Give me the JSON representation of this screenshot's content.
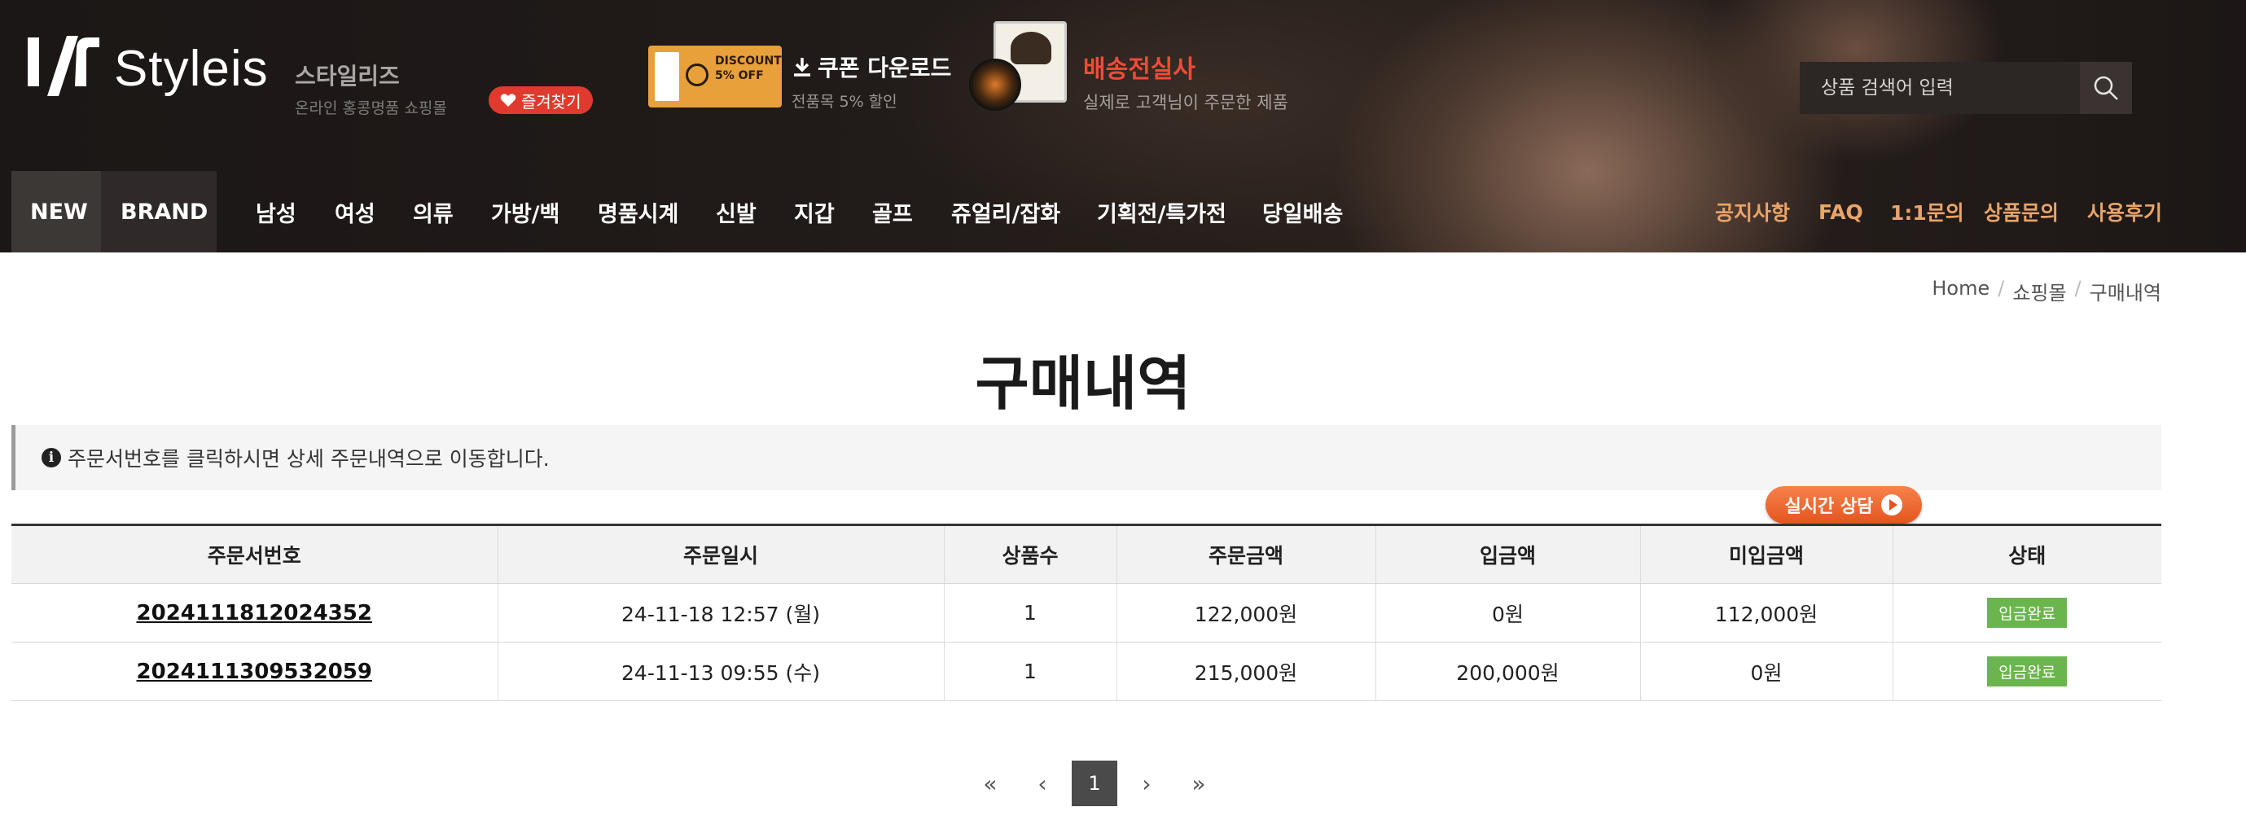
{
  "header": {
    "logo_text": "Styleis",
    "brand_korean": "스타일리즈",
    "brand_desc": "온라인 홍콩명품 쇼핑몰",
    "favorite_label": "즐겨찾기",
    "coupon_badge": "DISCOUNT 5% OFF",
    "coupon_title": "쿠폰 다운로드",
    "coupon_sub": "전품목 5% 할인",
    "delivery_title": "배송전실사",
    "delivery_sub": "실제로 고객님이 주문한 제품",
    "search_placeholder": "상품 검색어 입력"
  },
  "nav": {
    "items": [
      "NEW",
      "BRAND",
      "남성",
      "여성",
      "의류",
      "가방/백",
      "명품시계",
      "신발",
      "지갑",
      "골프",
      "쥬얼리/잡화",
      "기획전/특가전",
      "당일배송"
    ],
    "utility": [
      "공지사항",
      "FAQ",
      "1:1문의",
      "상품문의",
      "사용후기"
    ]
  },
  "breadcrumb": [
    "Home",
    "쇼핑몰",
    "구매내역"
  ],
  "page_title": "구매내역",
  "notice_text": "주문서번호를 클릭하시면 상세 주문내역으로 이동합니다.",
  "live_chat_label": "실시간 상담",
  "table": {
    "headers": [
      "주문서번호",
      "주문일시",
      "상품수",
      "주문금액",
      "입금액",
      "미입금액",
      "상태"
    ],
    "rows": [
      [
        "2024111812024352",
        "24-11-18 12:57 (월)",
        "1",
        "122,000원",
        "0원",
        "112,000원",
        "입금완료"
      ],
      [
        "2024111309532059",
        "24-11-13 09:55 (수)",
        "1",
        "215,000원",
        "200,000원",
        "0원",
        "입금완료"
      ]
    ]
  },
  "pagination": {
    "first": "«",
    "prev": "‹",
    "current": "1",
    "next": "›",
    "last": "»"
  },
  "colors": {
    "header_bg": "#1c1716",
    "nav_utility": "#e8a46a",
    "favorite_btn": "#e03a2f",
    "delivery_title": "#f24a3a",
    "status_badge": "#6bb54d",
    "live_chat": "#f0692f",
    "pager_active": "#4a4a4a"
  }
}
